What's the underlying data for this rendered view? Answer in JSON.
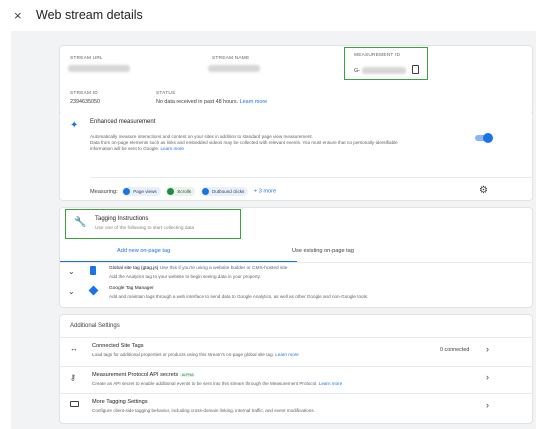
{
  "header": {
    "close_label": "×",
    "title": "Web stream details"
  },
  "stream_info": {
    "url_label": "STREAM URL",
    "name_label": "STREAM NAME",
    "measurement_id_label": "MEASUREMENT ID",
    "measurement_id_prefix": "G-",
    "stream_id_label": "STREAM ID",
    "stream_id": "2394635050",
    "status_label": "STATUS",
    "status_text": "No data received in past 48 hours.",
    "status_link": "Learn more"
  },
  "enhanced": {
    "title": "Enhanced measurement",
    "desc1": "Automatically measure interactions and content on your sites in addition to standard page view measurement.",
    "desc2": "Data from on-page elements such as links and embedded videos may be collected with relevant events. You must ensure that no personally-identifiable",
    "desc3": "information will be sent to Google.",
    "learn_more": "Learn more",
    "toggle_on": true,
    "measuring_label": "Measuring:",
    "chips": [
      "Page views",
      "Scrolls",
      "Outbound clicks"
    ],
    "more": "+ 3 more"
  },
  "tagging": {
    "title": "Tagging Instructions",
    "subtitle": "Use one of the following to start collecting data",
    "tabs": [
      "Add new on-page tag",
      "Use existing on-page tag"
    ],
    "options": [
      {
        "title": "Global site tag (gtag.js)",
        "title_suffix": "Use this if you're using a website builder or CMS-hosted site",
        "desc": "Add the Analytics tag to your website to begin seeing data in your property."
      },
      {
        "title": "Google Tag Manager",
        "desc": "Add and maintain tags through a web interface to send data to Google Analytics, as well as other Google and non-Google tools."
      }
    ]
  },
  "additional": {
    "title": "Additional Settings",
    "rows": [
      {
        "title": "Connected Site Tags",
        "desc": "Load tags for additional properties or products using this stream's on-page global site tag.",
        "link": "Learn more",
        "count": "0 connected"
      },
      {
        "title": "Measurement Protocol API secrets",
        "badge": "ALPHA",
        "desc": "Create an API secret to enable additional events to be sent into this stream through the Measurement Protocol.",
        "link": "Learn more"
      },
      {
        "title": "More Tagging Settings",
        "desc": "Configure client-side tagging behavior, including cross-domain linking, internal traffic, and event modifications."
      }
    ]
  },
  "colors": {
    "accent": "#1a73e8",
    "highlight": "#3aa33d",
    "panel_bg": "#f1f3f4"
  }
}
